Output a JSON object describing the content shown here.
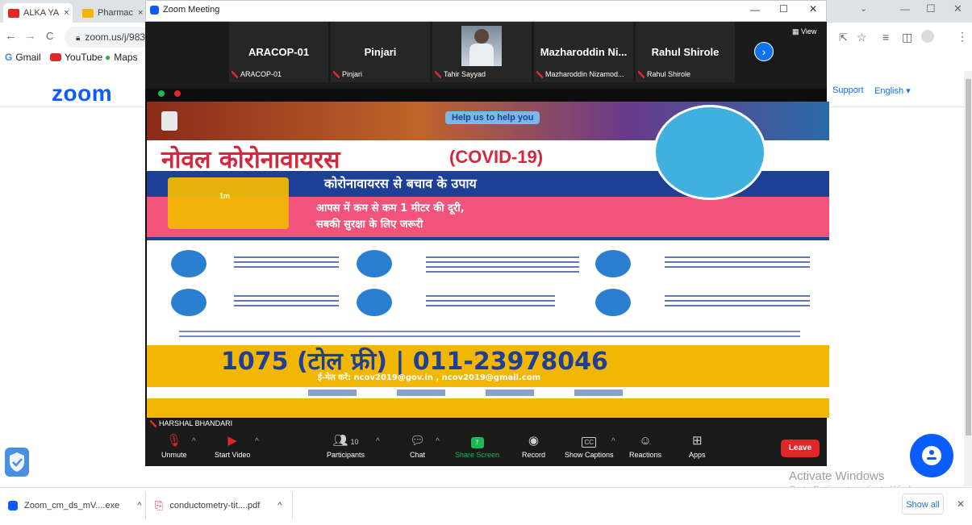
{
  "browser": {
    "tabs": [
      {
        "label": "ALKA YA",
        "close": "×"
      },
      {
        "label": "Pharmac",
        "close": "×"
      }
    ],
    "nav": {
      "back": "←",
      "forward": "→",
      "reload": "C"
    },
    "address": "zoom.us/j/9832",
    "bookmarks": [
      "Gmail",
      "YouTube",
      "Maps"
    ],
    "window_controls": {
      "minimize": "—",
      "maximize": "☐",
      "close": "✕"
    }
  },
  "zoom_page": {
    "logo": "zoom",
    "support": "Support",
    "language": "English ▾"
  },
  "zoom_window": {
    "title": "Zoom Meeting",
    "view_label": "View",
    "participants_strip": [
      {
        "name": "ARACOP-01",
        "label": "ARACOP-01"
      },
      {
        "name": "Pinjari",
        "label": "Pinjari"
      },
      {
        "name": "",
        "label": "Tahir Sayyad"
      },
      {
        "name": "Mazharoddin Ni...",
        "label": "Mazharoddin Nizamod..."
      },
      {
        "name": "Rahul Shirole",
        "label": "Rahul Shirole"
      }
    ],
    "sharer_label": "HARSHAL BHANDARI",
    "controls": [
      {
        "label": "Unmute",
        "icon": "mic-muted-icon"
      },
      {
        "label": "Start Video",
        "icon": "video-off-icon"
      },
      {
        "label": "Participants",
        "icon": "participants-icon",
        "count": "10"
      },
      {
        "label": "Chat",
        "icon": "chat-icon"
      },
      {
        "label": "Share Screen",
        "icon": "share-screen-icon"
      },
      {
        "label": "Record",
        "icon": "record-icon"
      },
      {
        "label": "Show Captions",
        "icon": "captions-icon"
      },
      {
        "label": "Reactions",
        "icon": "reactions-icon"
      },
      {
        "label": "Apps",
        "icon": "apps-icon"
      }
    ],
    "leave": "Leave"
  },
  "poster": {
    "help": "Help us to help you",
    "title_hi": "नोवल कोरोनावायरस",
    "title_en": "(COVID-19)",
    "subtitle": "कोरोनावायरस से बचाव के उपाय",
    "distance_label": "1m",
    "line1": "आपस में कम से कम 1 मीटर की दूरी,",
    "line2": "सबकी सुरक्षा के लिए जरूरी",
    "helpline": "1075 (टोल फ्री)  |  011-23978046",
    "email": "ई-मेल करें: ncov2019@gov.in , ncov2019@gmail.com"
  },
  "os": {
    "activate_title": "Activate Windows",
    "activate_sub": "Go to Settings to activate Windows."
  },
  "downloads": {
    "items": [
      {
        "name": "Zoom_cm_ds_mV....exe"
      },
      {
        "name": "conductometry-tit....pdf"
      }
    ],
    "show_all": "Show all",
    "close": "✕"
  },
  "colors": {
    "zoom_blue": "#0b5cff",
    "leave_red": "#e02828",
    "share_green": "#1db954",
    "poster_red": "#d7263d",
    "poster_blue": "#1e3f96",
    "poster_pink": "#f2537a",
    "poster_yellow": "#f2b705"
  }
}
